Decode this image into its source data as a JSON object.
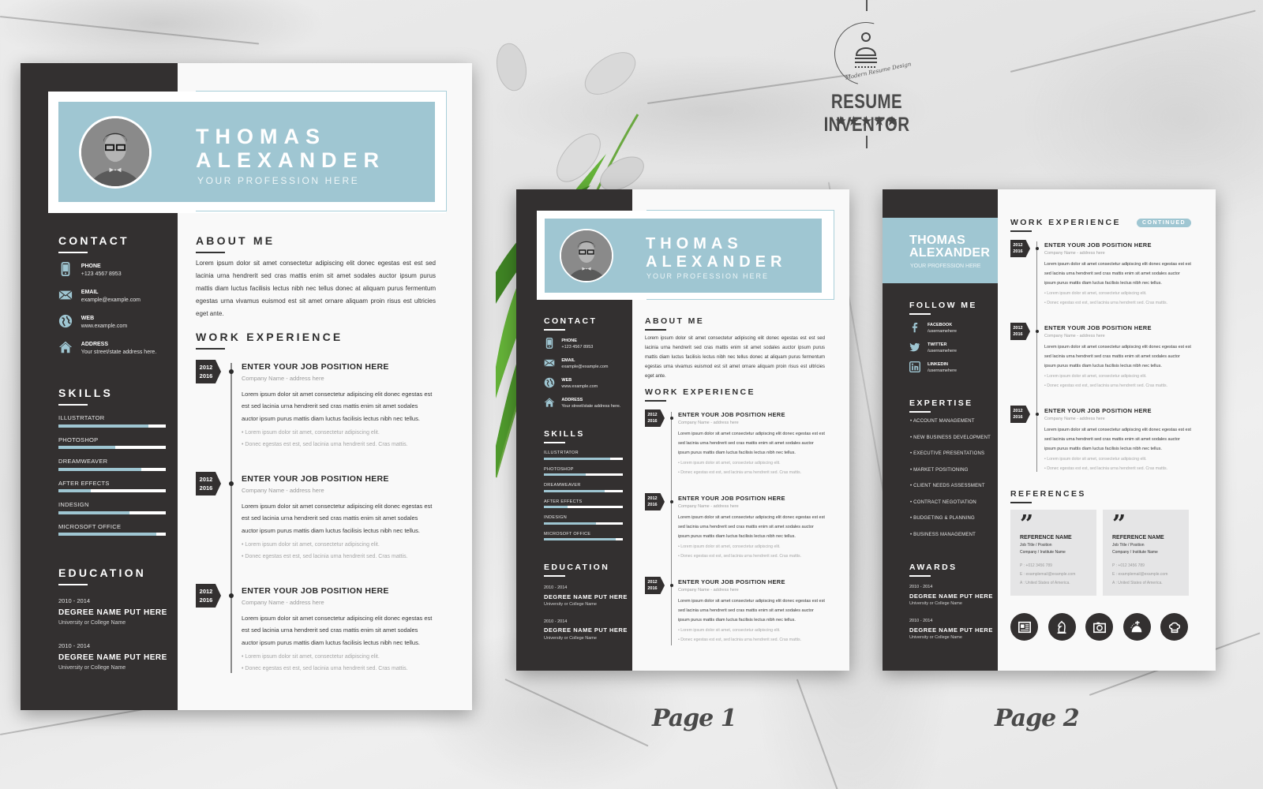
{
  "brand": {
    "name": "RESUME INVENTOR",
    "tagline": "Modern Resume Design",
    "rating_stars": "★★★★★",
    "rating": 5
  },
  "page_labels": [
    "Page 1",
    "Page 2"
  ],
  "resume": {
    "first_name": "THOMAS",
    "last_name": "ALEXANDER",
    "profession": "YOUR PROFESSION HERE",
    "sections": {
      "contact": "CONTACT",
      "skills": "SKILLS",
      "education": "EDUCATION",
      "about": "ABOUT ME",
      "work": "WORK EXPERIENCE",
      "follow": "FOLLOW ME",
      "expertise": "EXPERTISE",
      "awards": "AWARDS",
      "references": "REFERENCES",
      "continued": "CONTINUED"
    },
    "contact": [
      {
        "icon": "phone-icon",
        "label": "PHONE",
        "value": "+123 4567 8953"
      },
      {
        "icon": "email-icon",
        "label": "EMAIL",
        "value": "example@example.com"
      },
      {
        "icon": "globe-icon",
        "label": "WEB",
        "value": "www.example.com"
      },
      {
        "icon": "home-icon",
        "label": "ADDRESS",
        "value": "Your street/state address here."
      }
    ],
    "skills": [
      {
        "name": "ILLUSTRTATOR",
        "level": 0.84
      },
      {
        "name": "PHOTOSHOP",
        "level": 0.53
      },
      {
        "name": "DREAMWEAVER",
        "level": 0.77
      },
      {
        "name": "AFTER EFFECTS",
        "level": 0.3
      },
      {
        "name": "INDESIGN",
        "level": 0.66
      },
      {
        "name": "MICROSOFT OFFICE",
        "level": 0.91
      }
    ],
    "education": [
      {
        "dates": "2010 - 2014",
        "degree": "DEGREE NAME PUT HERE",
        "school": "University or College Name"
      },
      {
        "dates": "2010 - 2014",
        "degree": "DEGREE NAME PUT HERE",
        "school": "University or College Name"
      }
    ],
    "about": "Lorem ipsum dolor sit amet consectetur adipiscing elit donec egestas est est sed lacinia urna hendrerit sed cras mattis  enim sit amet sodales auctor ipsum purus mattis diam luctus facilisis lectus nibh nec tellus donec at aliquam purus fermentum egestas urna vivamus euismod est sit amet ornare aliquam proin risus est ultricies eget ante.",
    "jobs": [
      {
        "start": "2012",
        "end": "2016",
        "title": "ENTER YOUR JOB POSITION HERE",
        "company": "Company Name - address here",
        "desc": "Lorem ipsum dolor sit amet consectetur adipiscing elit donec egestas est est sed lacinia urna hendrerit sed cras mattis enim sit amet sodales auctor ipsum purus mattis diam luctus facilisis lectus nibh nec tellus.",
        "bullets": [
          "Lorem ipsum dolor sit amet, consectetur adipiscing elit.",
          "Donec egestas est est, sed lacinia urna hendrerit sed. Cras mattis."
        ]
      },
      {
        "start": "2012",
        "end": "2016",
        "title": "ENTER YOUR JOB POSITION HERE",
        "company": "Company Name - address here",
        "desc": "Lorem ipsum dolor sit amet consectetur adipiscing elit donec egestas est est sed lacinia urna hendrerit sed cras mattis enim sit amet sodales auctor ipsum purus mattis diam luctus facilisis lectus nibh nec tellus.",
        "bullets": [
          "Lorem ipsum dolor sit amet, consectetur adipiscing elit.",
          "Donec egestas est est, sed lacinia urna hendrerit sed. Cras mattis."
        ]
      },
      {
        "start": "2012",
        "end": "2016",
        "title": "ENTER YOUR JOB POSITION HERE",
        "company": "Company Name - address here",
        "desc": "Lorem ipsum dolor sit amet consectetur adipiscing elit donec egestas est est sed lacinia urna hendrerit sed cras mattis enim sit amet sodales auctor ipsum purus mattis diam luctus facilisis lectus nibh nec tellus.",
        "bullets": [
          "Lorem ipsum dolor sit amet, consectetur adipiscing elit.",
          "Donec egestas est est, sed lacinia urna hendrerit sed. Cras mattis."
        ]
      }
    ],
    "social": [
      {
        "icon": "facebook-icon",
        "label": "FACEBOOK",
        "value": "/usernamehere"
      },
      {
        "icon": "twitter-icon",
        "label": "TWITTER",
        "value": "/usernamehere"
      },
      {
        "icon": "linkedin-icon",
        "label": "LINKEDIN",
        "value": "/usernamehere"
      }
    ],
    "expertise": [
      "ACCOUNT MANAGEMENT",
      "NEW BUSINESS DEVELOPMENT",
      "EXECUTIVE PRESENTATIONS",
      "MARKET POSITIONING",
      "CLIENT NEEDS ASSESSMENT",
      "CONTRACT NEGOTIATION",
      "BUDGETING & PLANNING",
      "BUSINESS MANAGEMENT"
    ],
    "awards": [
      {
        "dates": "2010 - 2014",
        "degree": "DEGREE NAME PUT HERE",
        "school": "University or College Name"
      },
      {
        "dates": "2010 - 2014",
        "degree": "DEGREE NAME PUT HERE",
        "school": "University or College Name"
      }
    ],
    "references": [
      {
        "name": "REFERENCE NAME",
        "title": "Job Title / Position",
        "company": "Company / Institute Name",
        "phone": "P : +012 3456 789",
        "email": "E : examplemail@example.com",
        "address": "A : United States of America."
      },
      {
        "name": "REFERENCE NAME",
        "title": "Job Title / Position",
        "company": "Company / Institute Name",
        "phone": "P : +012 3456 789",
        "email": "E : examplemail@example.com",
        "address": "A : United States of America."
      }
    ],
    "hobbies": [
      "newspaper-icon",
      "chess-knight-icon",
      "camera-icon",
      "travel-plane-icon",
      "chef-hat-icon"
    ]
  },
  "colors": {
    "accent": "#9fc6d2",
    "sidebar": "#333030",
    "paper": "#f9f9f9"
  }
}
